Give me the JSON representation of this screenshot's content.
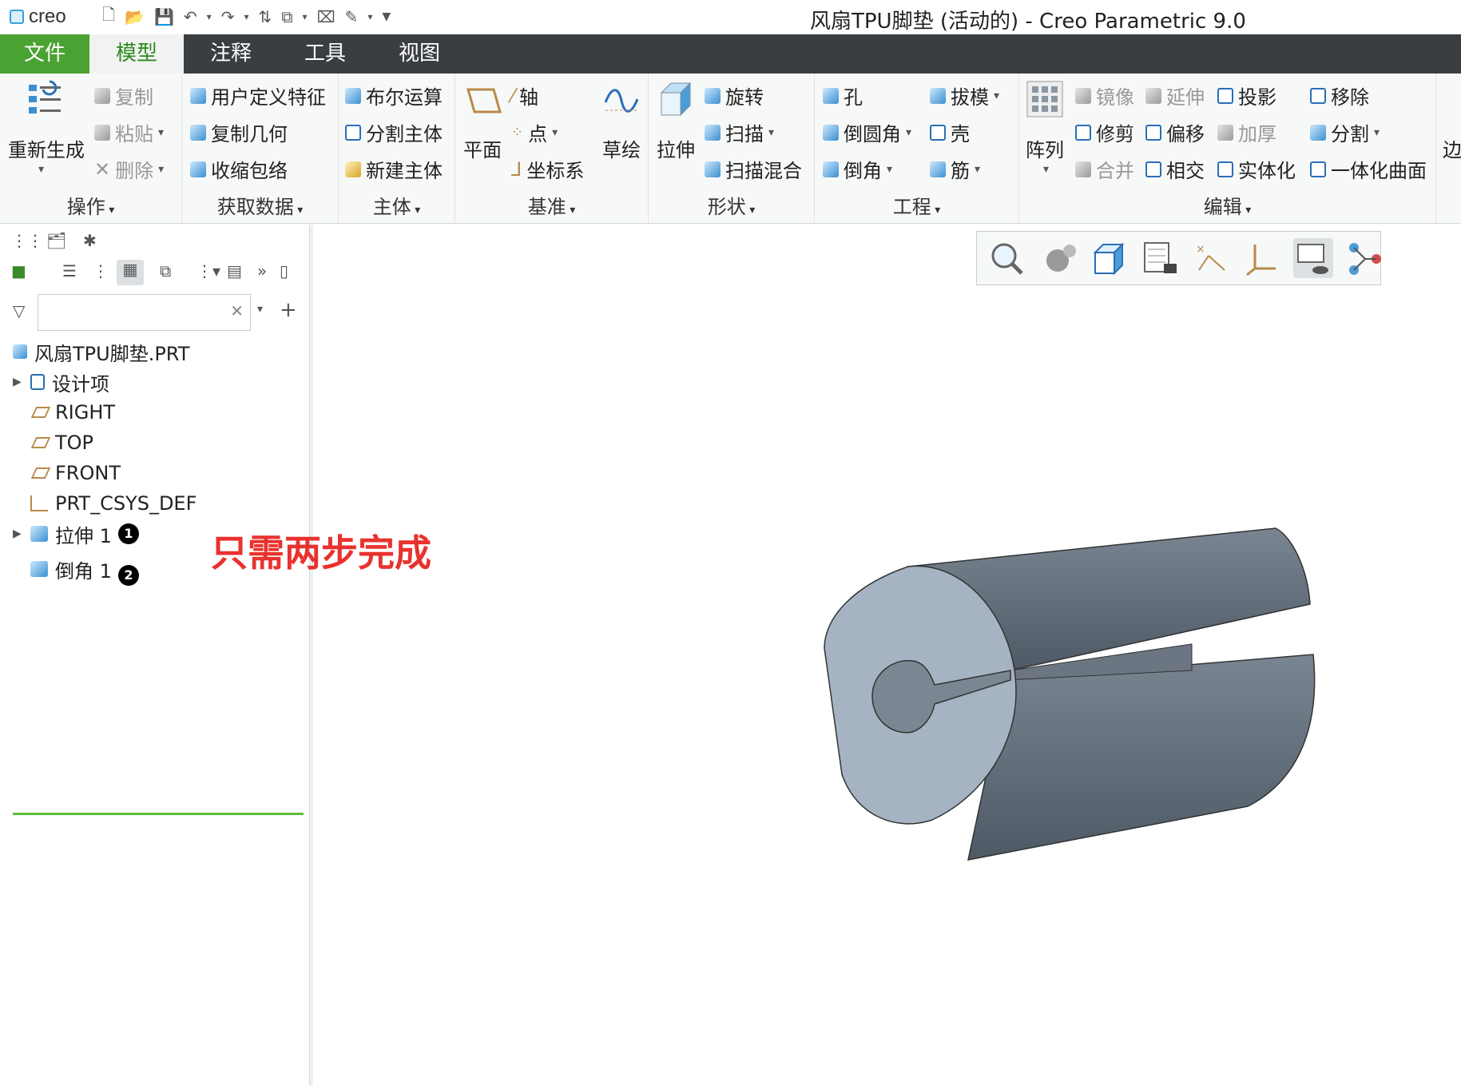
{
  "titlebar": {
    "logo_text": "creo",
    "title": "风扇TPU脚垫 (活动的) - Creo Parametric 9.0"
  },
  "tabs": [
    "文件",
    "模型",
    "注释",
    "工具",
    "视图"
  ],
  "ribbon": {
    "operations": {
      "name": "操作",
      "regenerate": "重新生成",
      "copy": "复制",
      "paste": "粘贴",
      "delete": "删除"
    },
    "get_data": {
      "name": "获取数据",
      "udf": "用户定义特征",
      "copy_geom": "复制几何",
      "shrinkwrap": "收缩包络"
    },
    "body": {
      "name": "主体",
      "boolean": "布尔运算",
      "split_body": "分割主体",
      "new_body": "新建主体"
    },
    "datum": {
      "name": "基准",
      "plane": "平面",
      "axis": "轴",
      "point": "点",
      "csys": "坐标系",
      "sketch": "草绘"
    },
    "shapes": {
      "name": "形状",
      "extrude": "拉伸",
      "revolve": "旋转",
      "sweep": "扫描",
      "swept_blend": "扫描混合"
    },
    "engineering": {
      "name": "工程",
      "hole": "孔",
      "draft": "拔模",
      "round": "倒圆角",
      "shell": "壳",
      "chamfer": "倒角",
      "rib": "筋"
    },
    "editing": {
      "name": "编辑",
      "pattern": "阵列",
      "mirror": "镜像",
      "extend": "延伸",
      "project": "投影",
      "remove": "移除",
      "trim": "修剪",
      "offset": "偏移",
      "thicken": "加厚",
      "split": "分割",
      "merge": "合并",
      "intersect": "相交",
      "solidify": "实体化",
      "unify": "一体化曲面"
    },
    "overflow": "边"
  },
  "model_tree": {
    "root": "风扇TPU脚垫.PRT",
    "items": [
      {
        "label": "设计项"
      },
      {
        "label": "RIGHT"
      },
      {
        "label": "TOP"
      },
      {
        "label": "FRONT"
      },
      {
        "label": "PRT_CSYS_DEF"
      },
      {
        "label": "拉伸 1",
        "badge": "1"
      },
      {
        "label": "倒角 1",
        "badge": "2"
      }
    ],
    "filter_placeholder": ""
  },
  "annotation": "只需两步完成",
  "colors": {
    "file_tab": "#4aa233",
    "tabbar": "#3b3e41",
    "model_face": "#9faebe",
    "model_side": "#5f6b78",
    "annotation": "#e8322e"
  }
}
